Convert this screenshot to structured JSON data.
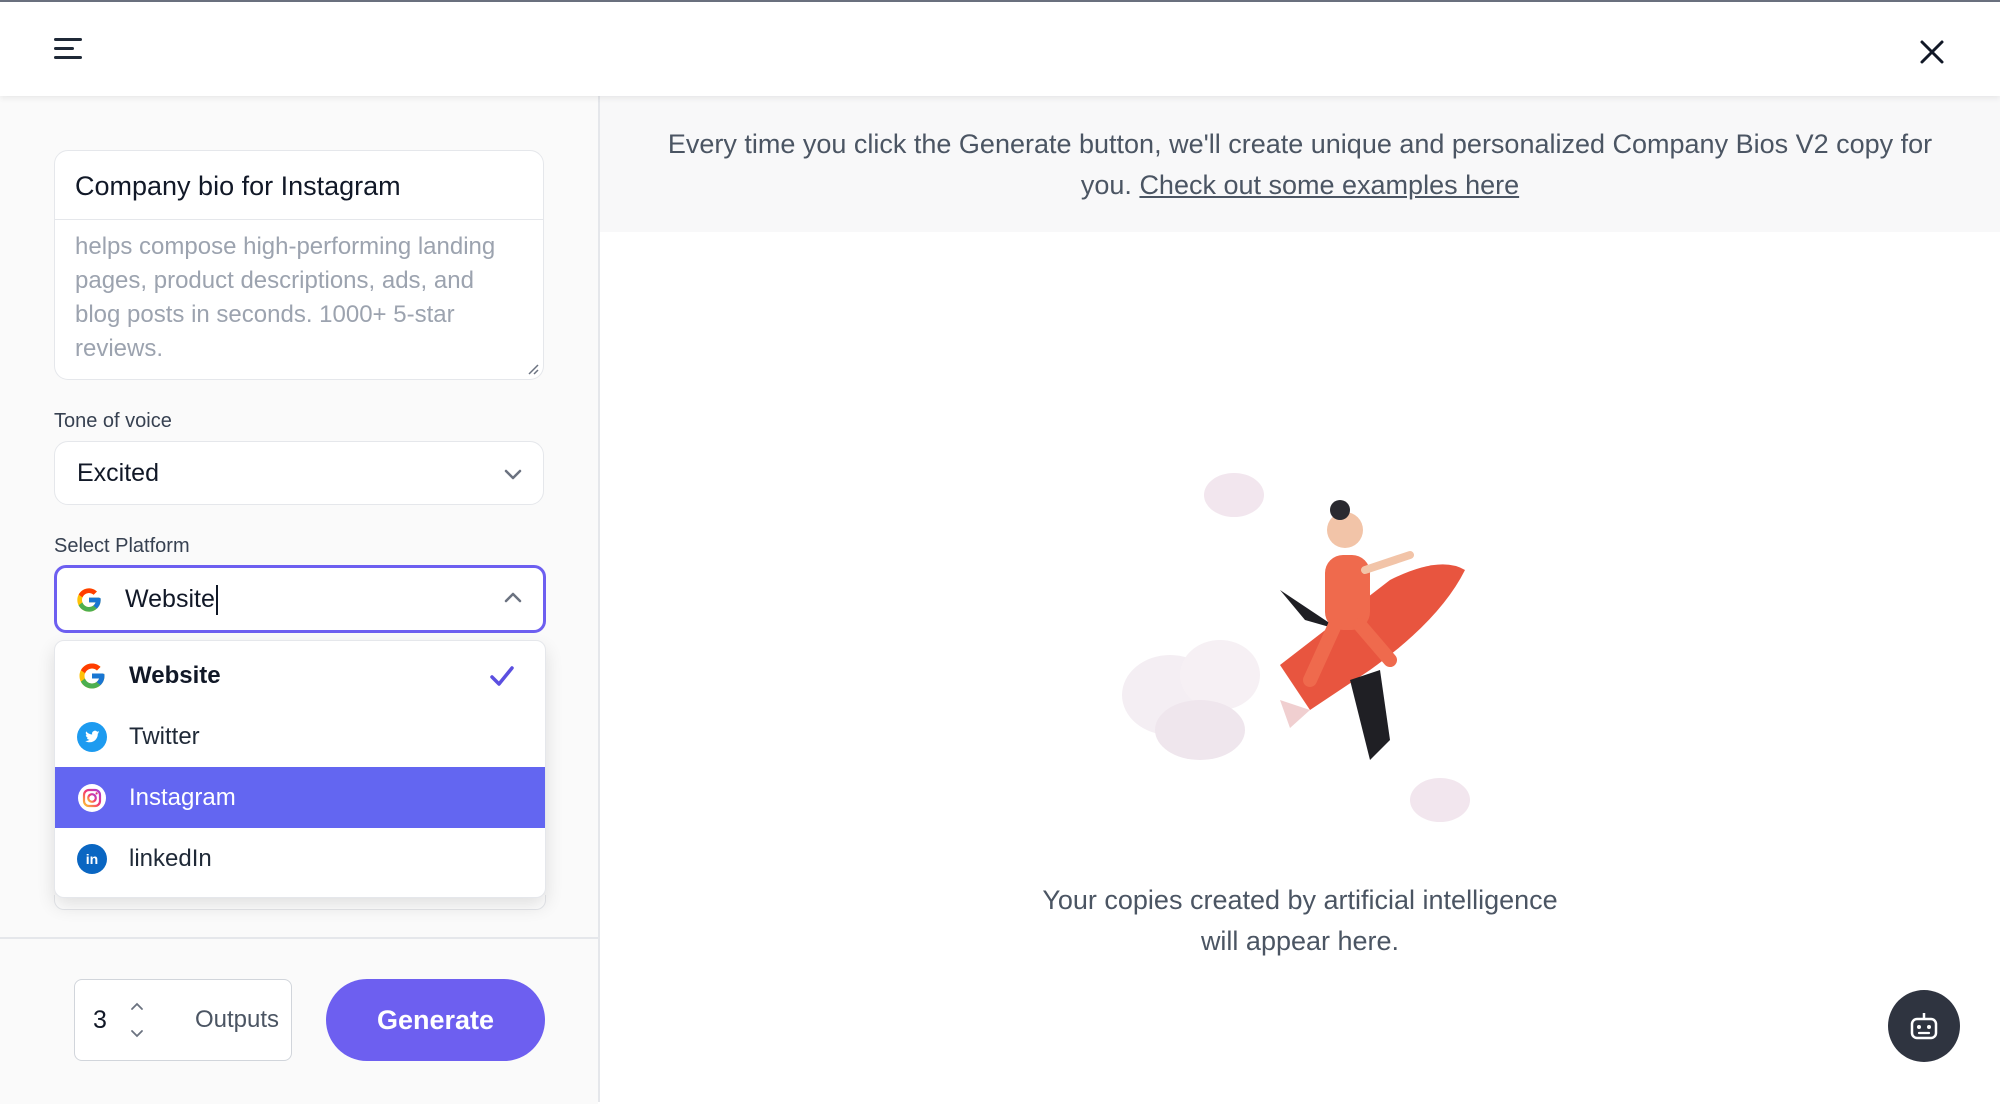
{
  "header": {
    "menu_icon": "hamburger-menu-icon",
    "close_icon": "close-x-icon"
  },
  "form": {
    "name_value": "Company bio for Instagram",
    "description_value": "helps compose high-performing landing pages, product descriptions, ads, and blog posts in seconds. 1000+ 5-star reviews.",
    "tone": {
      "label": "Tone of voice",
      "value": "Excited"
    },
    "platform": {
      "label": "Select Platform",
      "value": "Website",
      "options": [
        {
          "label": "Website",
          "icon": "google-icon",
          "selected": true
        },
        {
          "label": "Twitter",
          "icon": "twitter-icon",
          "selected": false
        },
        {
          "label": "Instagram",
          "icon": "instagram-icon",
          "selected": false,
          "highlighted": true
        },
        {
          "label": "linkedIn",
          "icon": "linkedin-icon",
          "selected": false
        }
      ]
    }
  },
  "footer": {
    "outputs_value": "3",
    "outputs_label": "Outputs",
    "generate_label": "Generate"
  },
  "main": {
    "info_text": "Every time you click the Generate button, we'll create unique and personalized Company Bios V2 copy for you.",
    "info_link": "Check out some examples here",
    "empty_line1": "Your copies created by artificial intelligence",
    "empty_line2": "will appear here."
  },
  "colors": {
    "accent": "#6d5ff0",
    "highlight": "#6366f1",
    "bot_button": "#2f3440"
  }
}
